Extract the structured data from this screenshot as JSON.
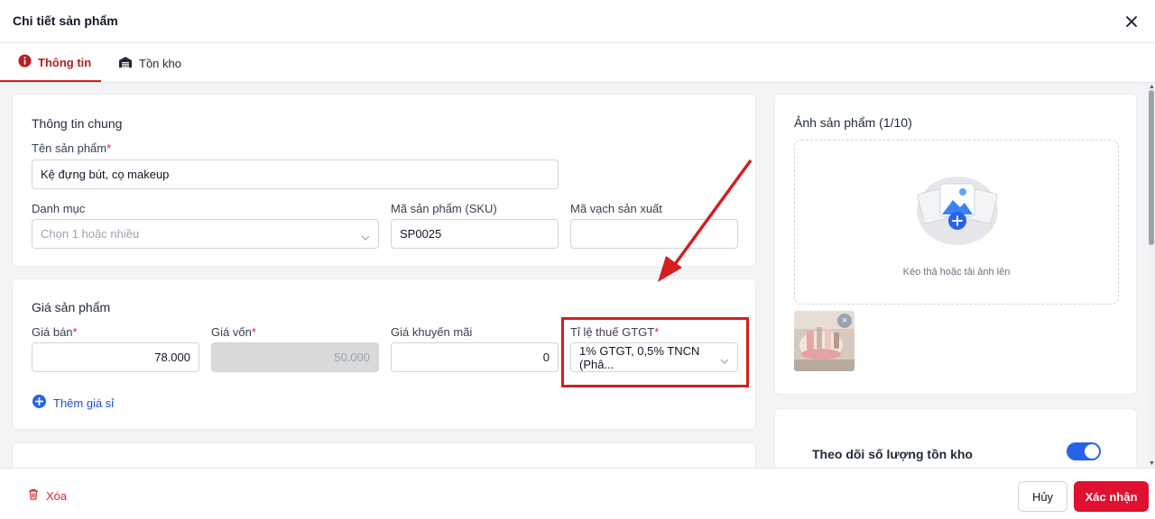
{
  "header": {
    "title": "Chi tiết sản phẩm"
  },
  "tabs": [
    {
      "label": "Thông tin",
      "icon": "info-icon",
      "active": true
    },
    {
      "label": "Tồn kho",
      "icon": "warehouse-icon",
      "active": false
    }
  ],
  "general": {
    "section_title": "Thông tin chung",
    "name_label": "Tên sản phẩm",
    "name_value": "Kệ đựng bút, cọ makeup",
    "category_label": "Danh mục",
    "category_placeholder": "Chọn 1 hoặc nhiều",
    "sku_label": "Mã sản phẩm (SKU)",
    "sku_value": "SP0025",
    "barcode_label": "Mã vạch sản xuất",
    "barcode_value": ""
  },
  "price": {
    "section_title": "Giá sản phẩm",
    "sale_label": "Giá bán",
    "sale_value": "78.000",
    "cost_label": "Giá vốn",
    "cost_value": "50.000",
    "promo_label": "Giá khuyến mãi",
    "promo_value": "0",
    "vat_label": "Tỉ lệ thuế GTGT",
    "vat_value": "1% GTGT, 0,5% TNCN (Phâ...",
    "add_wholesale_label": "Thêm giá sỉ",
    "required_mark": "*"
  },
  "images": {
    "section_title": "Ảnh sản phẩm (1/10)",
    "drop_hint": "Kéo thả hoặc tải ảnh lên"
  },
  "inventory": {
    "track_label": "Theo dõi số lượng tồn kho",
    "track_enabled": true
  },
  "footer": {
    "delete_label": "Xóa",
    "cancel_label": "Hủy",
    "confirm_label": "Xác nhận"
  },
  "colors": {
    "accent": "#e0112f",
    "tab_active": "#c81e1e",
    "link": "#1d4ed8",
    "toggle_on": "#2563eb",
    "annotation": "#d21f1f"
  }
}
